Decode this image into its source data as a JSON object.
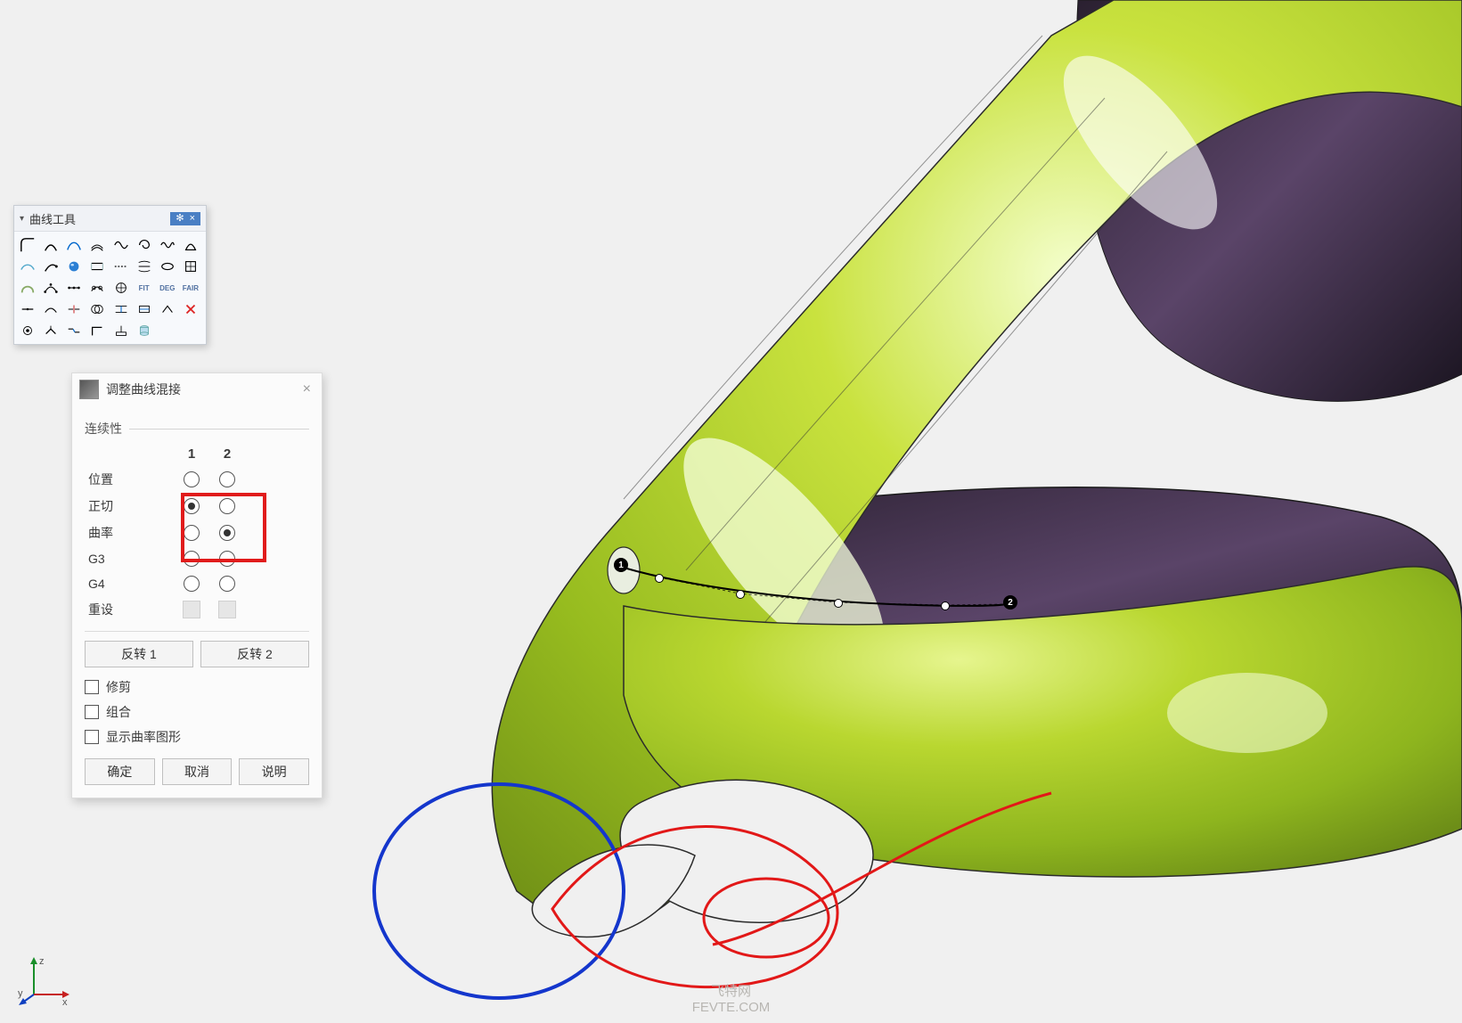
{
  "toolbar": {
    "title": "曲线工具",
    "gear_label": "✻",
    "close_label": "×"
  },
  "dialog": {
    "title": "调整曲线混接",
    "section_continuity": "连续性",
    "col1": "1",
    "col2": "2",
    "rows": {
      "position": "位置",
      "tangent": "正切",
      "curvature": "曲率",
      "g3": "G3",
      "g4": "G4",
      "reset": "重设"
    },
    "continuity_selection": {
      "col1": "tangent",
      "col2": "curvature"
    },
    "flip1": "反转 1",
    "flip2": "反转 2",
    "checks": {
      "trim": "修剪",
      "join": "组合",
      "show_curvature": "显示曲率图形"
    },
    "check_state": {
      "trim": false,
      "join": false,
      "show_curvature": false
    },
    "actions": {
      "ok": "确定",
      "cancel": "取消",
      "help": "说明"
    }
  },
  "viewport": {
    "marker1": "1",
    "marker2": "2"
  },
  "axis": {
    "z": "z",
    "x": "x",
    "y": "y"
  },
  "watermark": {
    "line1": "飞特网",
    "line2": "FEVTE.COM"
  }
}
